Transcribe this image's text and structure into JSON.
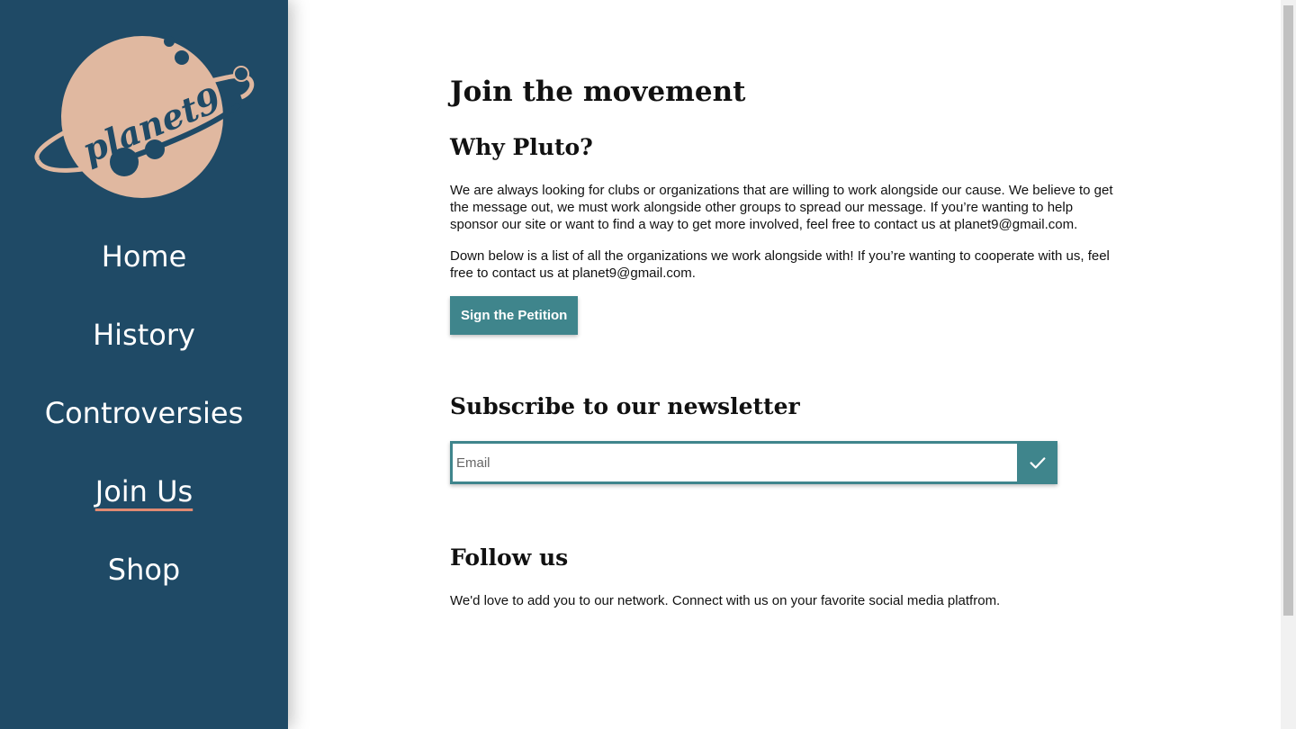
{
  "brand": {
    "logo_text": "planet9",
    "colors": {
      "sidebar": "#1f4a66",
      "logo": "#e0b8a0",
      "accent": "#3f858c",
      "underline": "#e08a72"
    }
  },
  "nav": {
    "items": [
      {
        "label": "Home",
        "active": false
      },
      {
        "label": "History",
        "active": false
      },
      {
        "label": "Controversies",
        "active": false
      },
      {
        "label": "Join Us",
        "active": true
      },
      {
        "label": "Shop",
        "active": false
      }
    ]
  },
  "main": {
    "title": "Join the movement",
    "why": {
      "title": "Why Pluto?",
      "paragraph1": "We are always looking for clubs or organizations that are willing to work alongside our cause. We believe to get the message out, we must work alongside other groups to spread our message. If you’re wanting to help sponsor our site or want to find a way to get more involved, feel free to contact us at planet9@gmail.com.",
      "paragraph2": "Down below is a list of all the organizations we work alongside with! If you’re wanting to cooperate with us, feel free to contact us at planet9@gmail.com.",
      "button_label": "Sign the Petition"
    },
    "subscribe": {
      "title": "Subscribe to our newsletter",
      "email_placeholder": "Email",
      "email_value": "",
      "submit_icon": "checkmark-icon"
    },
    "follow": {
      "title": "Follow us",
      "text": "We'd love to add you to our network. Connect with us on your favorite social media platfrom."
    }
  }
}
